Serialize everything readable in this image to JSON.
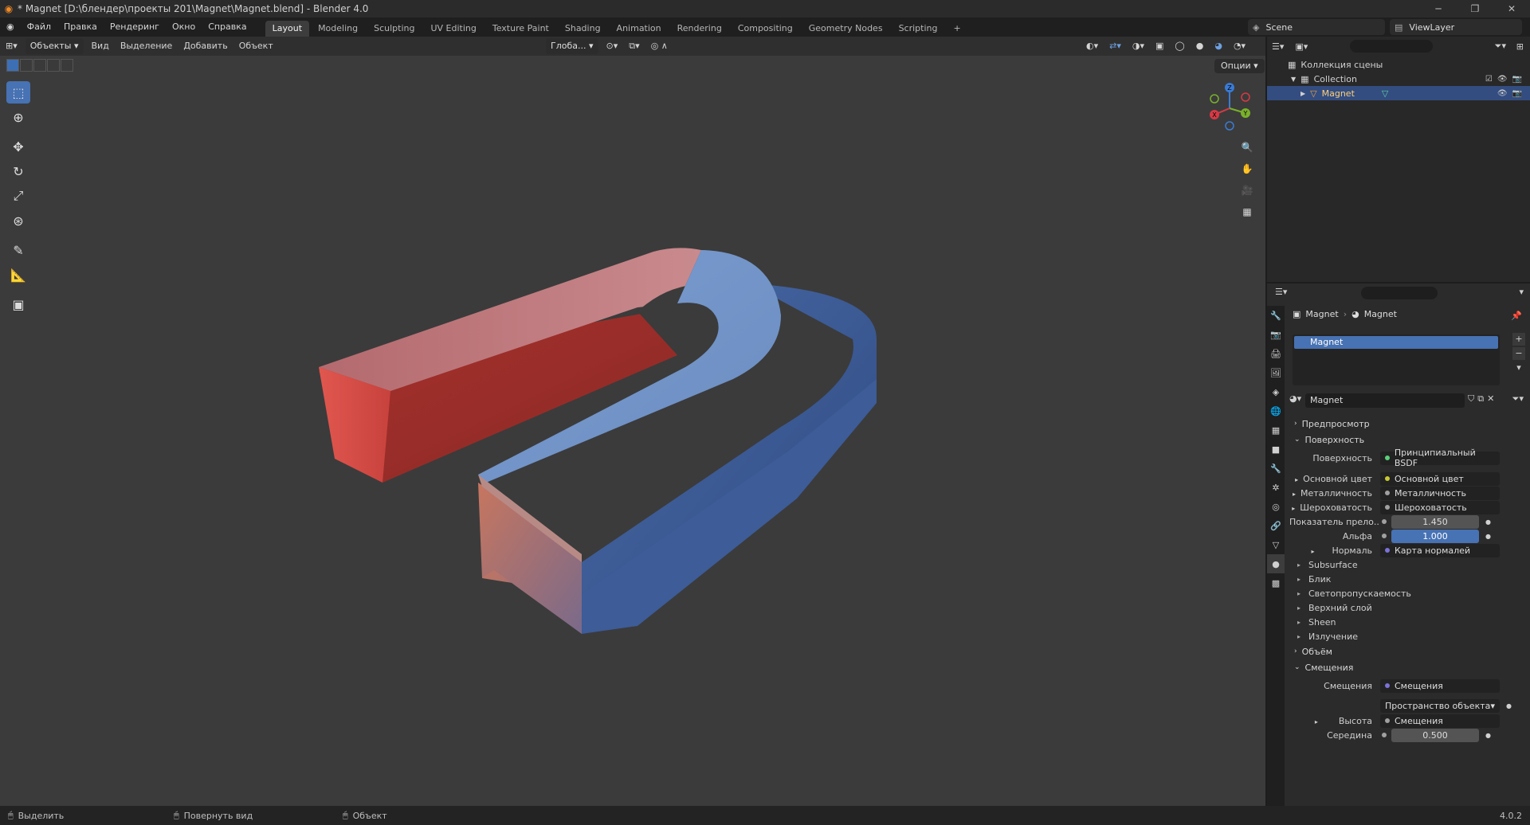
{
  "window": {
    "title": "* Magnet [D:\\блендер\\проекты 201\\Magnet\\Magnet.blend] - Blender 4.0",
    "minimize": "─",
    "maximize": "❐",
    "close": "✕"
  },
  "menu": {
    "file": "Файл",
    "edit": "Правка",
    "render": "Рендеринг",
    "window": "Окно",
    "help": "Справка"
  },
  "workspaces": [
    "Layout",
    "Modeling",
    "Sculpting",
    "UV Editing",
    "Texture Paint",
    "Shading",
    "Animation",
    "Rendering",
    "Compositing",
    "Geometry Nodes",
    "Scripting",
    "+"
  ],
  "active_workspace_index": 0,
  "scene": {
    "name": "Scene",
    "view_layer": "ViewLayer"
  },
  "viewport": {
    "mode": "Объекты",
    "menu_view": "Вид",
    "menu_select": "Выделение",
    "menu_add": "Добавить",
    "menu_object": "Объект",
    "orientation": "Глоба...",
    "options": "Опции",
    "gizmo": {
      "x": "X",
      "y": "Y",
      "z": "Z"
    }
  },
  "outliner": {
    "root": "Коллекция сцены",
    "collection": "Collection",
    "object": "Magnet"
  },
  "properties": {
    "breadcrumb_object": "Magnet",
    "breadcrumb_material": "Magnet",
    "slot_name": "Magnet",
    "material_name": "Magnet",
    "panels": {
      "preview": "Предпросмотр",
      "surface": "Поверхность",
      "volume": "Объём",
      "displacement": "Смещения"
    },
    "surface_label": "Поверхность",
    "surface_value": "Принципиальный BSDF",
    "base_color_label": "Основной цвет",
    "base_color_value": "Основной цвет",
    "metallic_label": "Металличность",
    "metallic_value": "Металличность",
    "roughness_label": "Шероховатость",
    "roughness_value": "Шероховатость",
    "ior_label": "Показатель прело...",
    "ior_value": "1.450",
    "alpha_label": "Альфа",
    "alpha_value": "1.000",
    "normal_label": "Нормаль",
    "normal_value": "Карта нормалей",
    "subpanels": [
      "Subsurface",
      "Блик",
      "Светопропускаемость",
      "Верхний слой",
      "Sheen",
      "Излучение"
    ],
    "disp_label": "Смещения",
    "disp_value": "Смещения",
    "disp_space": "Пространство объекта",
    "height_label": "Высота",
    "height_value": "Смещения",
    "midlevel_label": "Середина",
    "midlevel_value": "0.500"
  },
  "statusbar": {
    "select": "Выделить",
    "rotate": "Повернуть вид",
    "object": "Объект",
    "version": "4.0.2"
  }
}
